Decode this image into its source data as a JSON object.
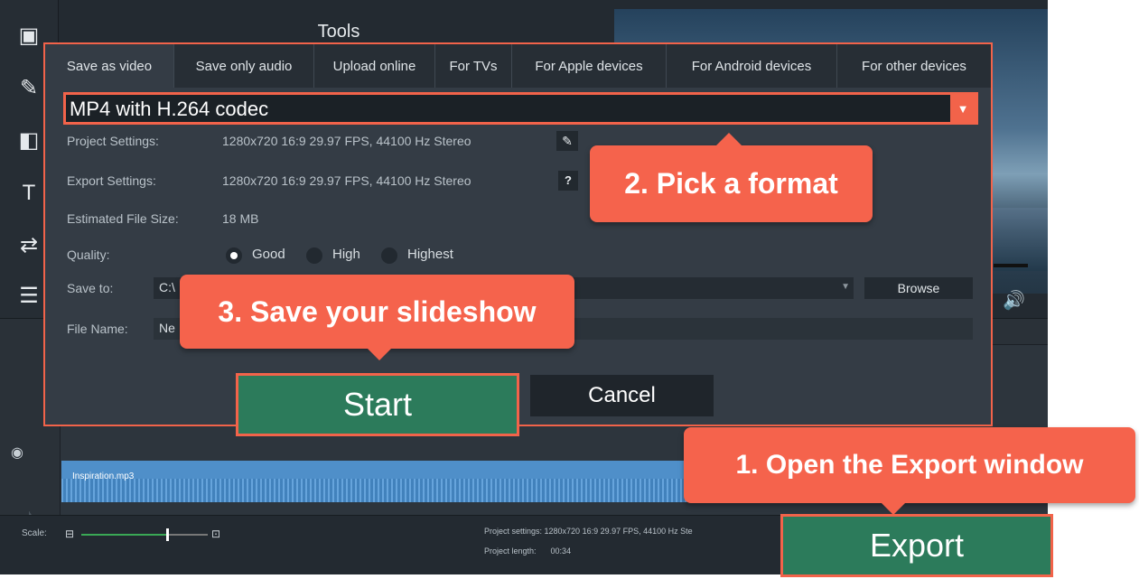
{
  "app": {
    "tools_title": "Tools"
  },
  "sidebar": {
    "items": [
      {
        "icon": "film-icon",
        "glyph": "▣"
      },
      {
        "icon": "wand-icon",
        "glyph": "✎"
      },
      {
        "icon": "clip-icon",
        "glyph": "◧"
      },
      {
        "icon": "text-icon",
        "glyph": "T"
      },
      {
        "icon": "transition-icon",
        "glyph": "⇄"
      },
      {
        "icon": "list-icon",
        "glyph": "☰"
      }
    ]
  },
  "dialog": {
    "tabs": [
      "Save as video",
      "Save only audio",
      "Upload online",
      "For TVs",
      "For Apple devices",
      "For Android devices",
      "For other devices"
    ],
    "format": "MP4 with H.264 codec",
    "project_settings_label": "Project Settings:",
    "project_settings_value": "1280x720 16:9 29.97 FPS, 44100 Hz Stereo",
    "export_settings_label": "Export Settings:",
    "export_settings_value": "1280x720 16:9 29.97 FPS, 44100 Hz Stereo",
    "help_glyph": "?",
    "file_size_label": "Estimated File Size:",
    "file_size_value": "18 MB",
    "quality_label": "Quality:",
    "quality_options": [
      "Good",
      "High",
      "Highest"
    ],
    "quality_selected": "Good",
    "save_to_label": "Save to:",
    "save_to_value": "C:\\",
    "browse_label": "Browse",
    "file_name_label": "File Name:",
    "file_name_value": "Ne",
    "start_label": "Start",
    "cancel_label": "Cancel"
  },
  "timeline": {
    "audio_clip": "Inspiration.mp3"
  },
  "bottom": {
    "scale_label": "Scale:",
    "scale_level": 0.68,
    "project_settings": "Project settings:  1280x720 16:9 29.97 FPS, 44100 Hz Ste",
    "project_length_label": "Project length:",
    "project_length_value": "00:34"
  },
  "export_label": "Export",
  "callouts": {
    "step1": "1. Open the Export window",
    "step2": "2. Pick a format",
    "step3": "3. Save your slideshow"
  },
  "colors": {
    "accent": "#f5634c",
    "primary_button": "#2c7b5b",
    "dialog_bg": "#343c45"
  }
}
